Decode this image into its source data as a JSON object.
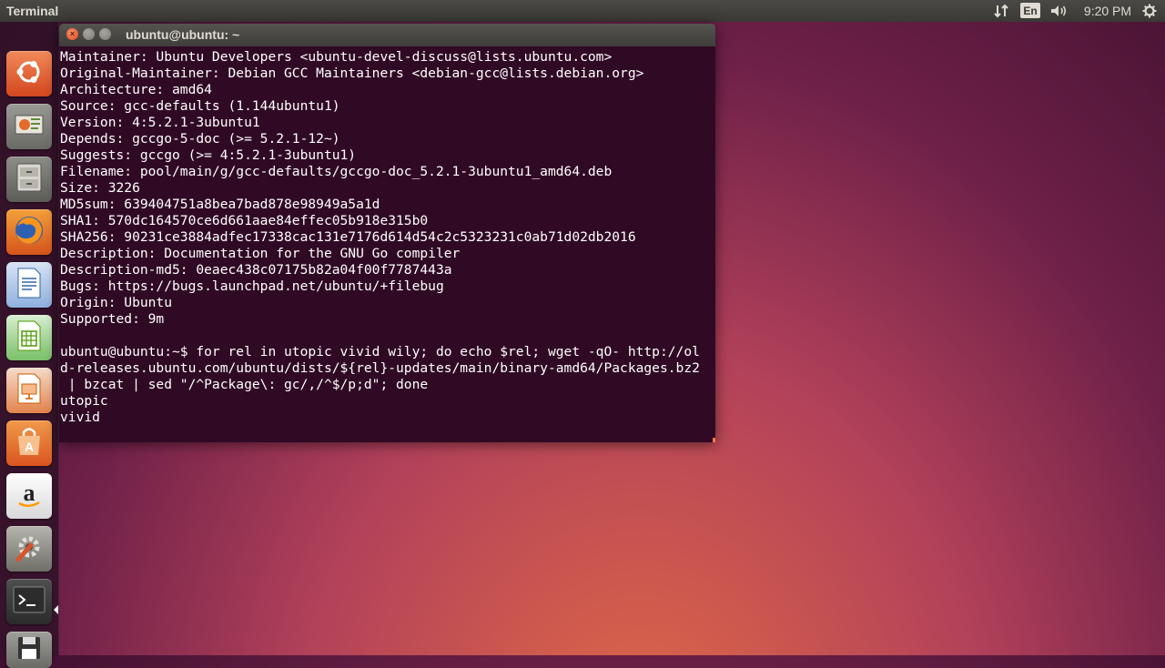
{
  "top_panel": {
    "app_name": "Terminal",
    "keyboard_layout": "En",
    "clock": "9:20 PM",
    "icons": [
      "network-icon",
      "keyboard-indicator",
      "volume-icon",
      "session-gear-icon"
    ]
  },
  "launcher": {
    "items": [
      {
        "name": "dash-home",
        "icon": "ubuntu-logo-icon"
      },
      {
        "name": "install-ubuntu",
        "icon": "installer-icon"
      },
      {
        "name": "files",
        "icon": "file-cabinet-icon"
      },
      {
        "name": "firefox",
        "icon": "firefox-icon"
      },
      {
        "name": "libreoffice-writer",
        "icon": "writer-icon"
      },
      {
        "name": "libreoffice-calc",
        "icon": "calc-icon"
      },
      {
        "name": "libreoffice-impress",
        "icon": "impress-icon"
      },
      {
        "name": "ubuntu-software-center",
        "icon": "shopping-bag-icon"
      },
      {
        "name": "amazon",
        "icon": "amazon-icon"
      },
      {
        "name": "system-settings",
        "icon": "wrench-gear-icon"
      },
      {
        "name": "terminal",
        "icon": "terminal-icon"
      },
      {
        "name": "save",
        "icon": "floppy-icon"
      }
    ]
  },
  "window": {
    "title": "ubuntu@ubuntu: ~",
    "close_glyph": "×"
  },
  "terminal": {
    "lines": [
      "Maintainer: Ubuntu Developers <ubuntu-devel-discuss@lists.ubuntu.com>",
      "Original-Maintainer: Debian GCC Maintainers <debian-gcc@lists.debian.org>",
      "Architecture: amd64",
      "Source: gcc-defaults (1.144ubuntu1)",
      "Version: 4:5.2.1-3ubuntu1",
      "Depends: gccgo-5-doc (>= 5.2.1-12~)",
      "Suggests: gccgo (>= 4:5.2.1-3ubuntu1)",
      "Filename: pool/main/g/gcc-defaults/gccgo-doc_5.2.1-3ubuntu1_amd64.deb",
      "Size: 3226",
      "MD5sum: 639404751a8bea7bad878e98949a5a1d",
      "SHA1: 570dc164570ce6d661aae84effec05b918e315b0",
      "SHA256: 90231ce3884adfec17338cac131e7176d614d54c2c5323231c0ab71d02db2016",
      "Description: Documentation for the GNU Go compiler",
      "Description-md5: 0eaec438c07175b82a04f00f7787443a",
      "Bugs: https://bugs.launchpad.net/ubuntu/+filebug",
      "Origin: Ubuntu",
      "Supported: 9m",
      "",
      "ubuntu@ubuntu:~$ for rel in utopic vivid wily; do echo $rel; wget -qO- http://ol",
      "d-releases.ubuntu.com/ubuntu/dists/${rel}-updates/main/binary-amd64/Packages.bz2",
      " | bzcat | sed \"/^Package\\: gc/,/^$/p;d\"; done",
      "utopic",
      "vivid"
    ]
  }
}
